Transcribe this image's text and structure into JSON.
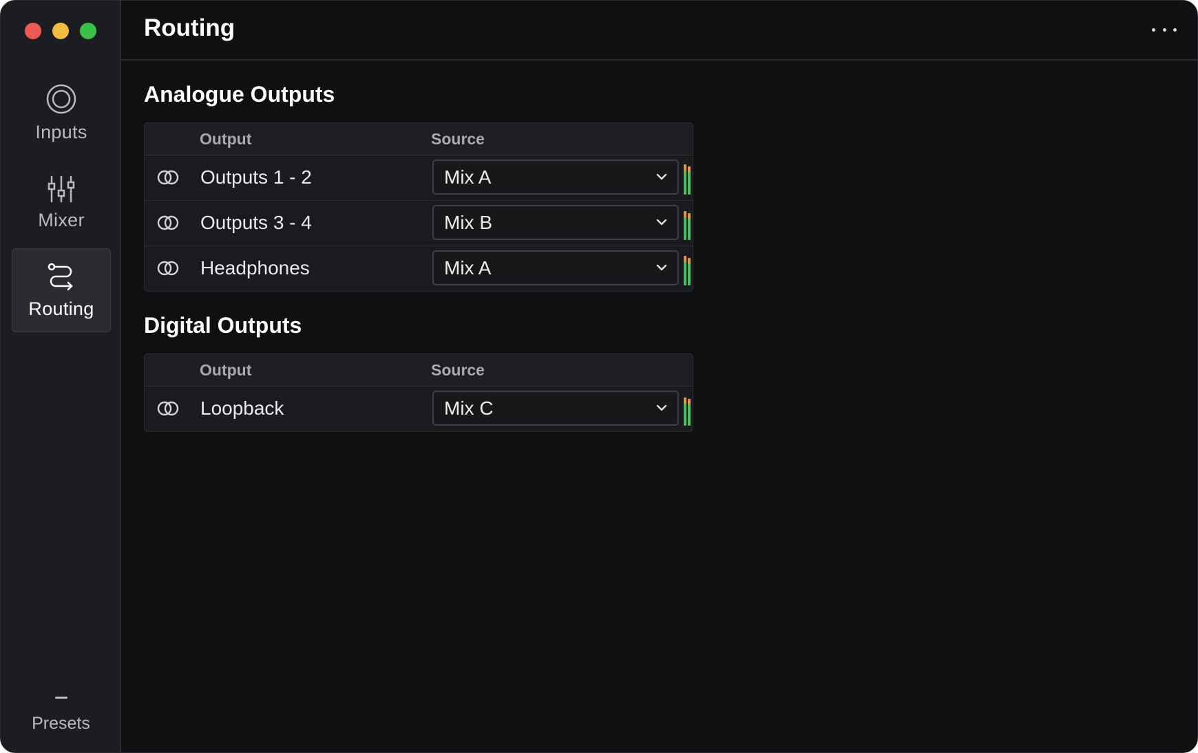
{
  "window": {
    "title": "Routing"
  },
  "sidebar": {
    "items": [
      {
        "label": "Inputs",
        "icon": "inputs-icon",
        "active": false
      },
      {
        "label": "Mixer",
        "icon": "mixer-sliders-icon",
        "active": false
      },
      {
        "label": "Routing",
        "icon": "routing-icon",
        "active": true
      }
    ],
    "presets_label": "Presets"
  },
  "header": {
    "more_icon": "more-dots-icon"
  },
  "analogue": {
    "title": "Analogue Outputs",
    "col_output": "Output",
    "col_source": "Source",
    "rows": [
      {
        "output": "Outputs 1 - 2",
        "source": "Mix A",
        "level": 0.92
      },
      {
        "output": "Outputs 3 - 4",
        "source": "Mix B",
        "level": 0.88
      },
      {
        "output": "Headphones",
        "source": "Mix A",
        "level": 0.9
      }
    ]
  },
  "digital": {
    "title": "Digital Outputs",
    "col_output": "Output",
    "col_source": "Source",
    "rows": [
      {
        "output": "Loopback",
        "source": "Mix C",
        "level": 0.85
      }
    ]
  },
  "colors": {
    "accent_red": "#ed5b53",
    "accent_yellow": "#f3bd3f",
    "accent_green": "#3bc14a",
    "meter_green": "#43c15a",
    "meter_orange": "#e0973a"
  }
}
